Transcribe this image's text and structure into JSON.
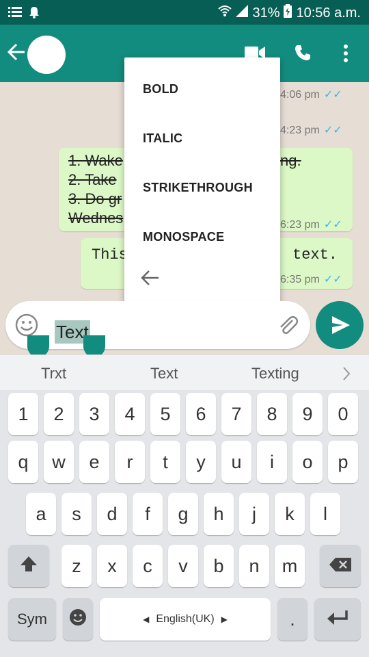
{
  "status_bar": {
    "battery": "31%",
    "time": "10:56 a.m."
  },
  "messages": [
    {
      "lines": [
        "1. Wake",
        "2. Take",
        "3. Do gr",
        "Wednes"
      ],
      "line_tail": "ng.",
      "time": "6:23 pm"
    },
    {
      "text_left": "This",
      "text_right": "text.",
      "time": "6:35 pm"
    }
  ],
  "earlier_times": [
    "4:06 pm",
    "4:23 pm"
  ],
  "format_menu": {
    "items": [
      "BOLD",
      "ITALIC",
      "STRIKETHROUGH",
      "MONOSPACE"
    ]
  },
  "input": {
    "value": "Text"
  },
  "suggestions": [
    "Trxt",
    "Text",
    "Texting"
  ],
  "keyboard": {
    "row_numbers": [
      "1",
      "2",
      "3",
      "4",
      "5",
      "6",
      "7",
      "8",
      "9",
      "0"
    ],
    "row_q": [
      "q",
      "w",
      "e",
      "r",
      "t",
      "y",
      "u",
      "i",
      "o",
      "p"
    ],
    "row_a": [
      "a",
      "s",
      "d",
      "f",
      "g",
      "h",
      "j",
      "k",
      "l"
    ],
    "row_z": [
      "z",
      "x",
      "c",
      "v",
      "b",
      "n",
      "m"
    ],
    "sym_label": "Sym",
    "space_label": "English(UK)",
    "period_label": "."
  },
  "colors": {
    "header": "#128c7e",
    "statusbar": "#075e54",
    "bubble": "#dcf8c6",
    "ticks": "#34b7f1"
  }
}
